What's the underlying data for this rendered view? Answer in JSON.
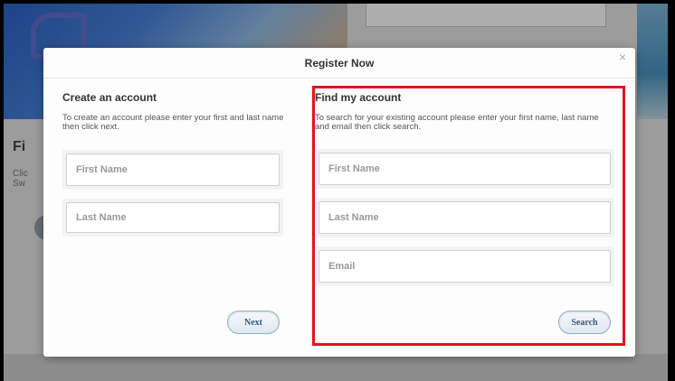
{
  "modal": {
    "title": "Register Now",
    "close_label": "×"
  },
  "create": {
    "title": "Create an account",
    "description": "To create an account please enter your first and last name then click next.",
    "first_name_placeholder": "First Name",
    "last_name_placeholder": "Last Name",
    "next_label": "Next"
  },
  "find": {
    "title": "Find my account",
    "description": "To search for your existing account please enter your first name, last name and email then click search.",
    "first_name_placeholder": "First Name",
    "last_name_placeholder": "Last Name",
    "email_placeholder": "Email",
    "search_label": "Search"
  },
  "background": {
    "heading": "Fi",
    "text_line1": "Clic",
    "text_line2": "Sw"
  },
  "colors": {
    "highlight": "#e0161e",
    "button_border": "#8fb0c4"
  }
}
